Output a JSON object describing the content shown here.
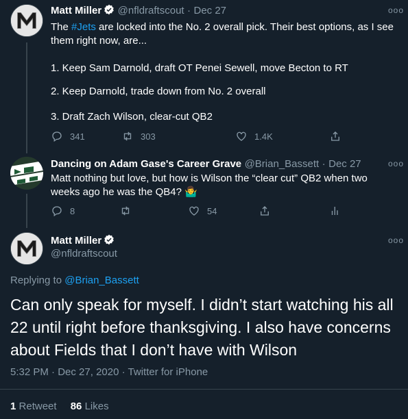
{
  "tweet1": {
    "name": "Matt Miller",
    "handle": "@nfldraftscout",
    "sep": "·",
    "date": "Dec 27",
    "text_pre": "The ",
    "hashtag": "#Jets",
    "text_post": " are locked into the No. 2 overall pick. Their best options, as I see them right now, are...",
    "option1": "1. Keep Sam Darnold, draft OT Penei Sewell, move Becton to RT",
    "option2": "2. Keep Darnold, trade down from No. 2 overall",
    "option3": "3. Draft Zach Wilson, clear-cut QB2",
    "replies": "341",
    "retweets": "303",
    "likes": "1.4K"
  },
  "tweet2": {
    "name": "Dancing on Adam Gase's Career Grave",
    "handle": "@Brian_Bassett",
    "sep": "·",
    "date": "Dec 27",
    "text": "Matt nothing but love, but how is Wilson the “clear cut” QB2 when two weeks ago he was the QB4? 🤷‍♂️",
    "replies": "8",
    "retweets": "",
    "likes": "54"
  },
  "main": {
    "name": "Matt Miller",
    "handle": "@nfldraftscout",
    "replying_label": "Replying to ",
    "replying_to": "@Brian_Bassett",
    "text": "Can only speak for myself. I didn’t start watching his all 22 until right before thanksgiving. I also have concerns about Fields that I don’t have with Wilson",
    "time": "5:32 PM",
    "sep1": "·",
    "date": "Dec 27, 2020",
    "sep2": "·",
    "source": "Twitter for iPhone",
    "retweet_count": "1",
    "retweet_label": "Retweet",
    "like_count": "86",
    "like_label": "Likes"
  },
  "colors": {
    "background": "#15202b",
    "text": "#ffffff",
    "muted": "#8899a6",
    "link": "#1da1f2",
    "verified": "#ffffff"
  },
  "icons": [
    "reply-icon",
    "retweet-icon",
    "like-icon",
    "share-icon",
    "analytics-icon",
    "verified-icon",
    "more-icon"
  ]
}
